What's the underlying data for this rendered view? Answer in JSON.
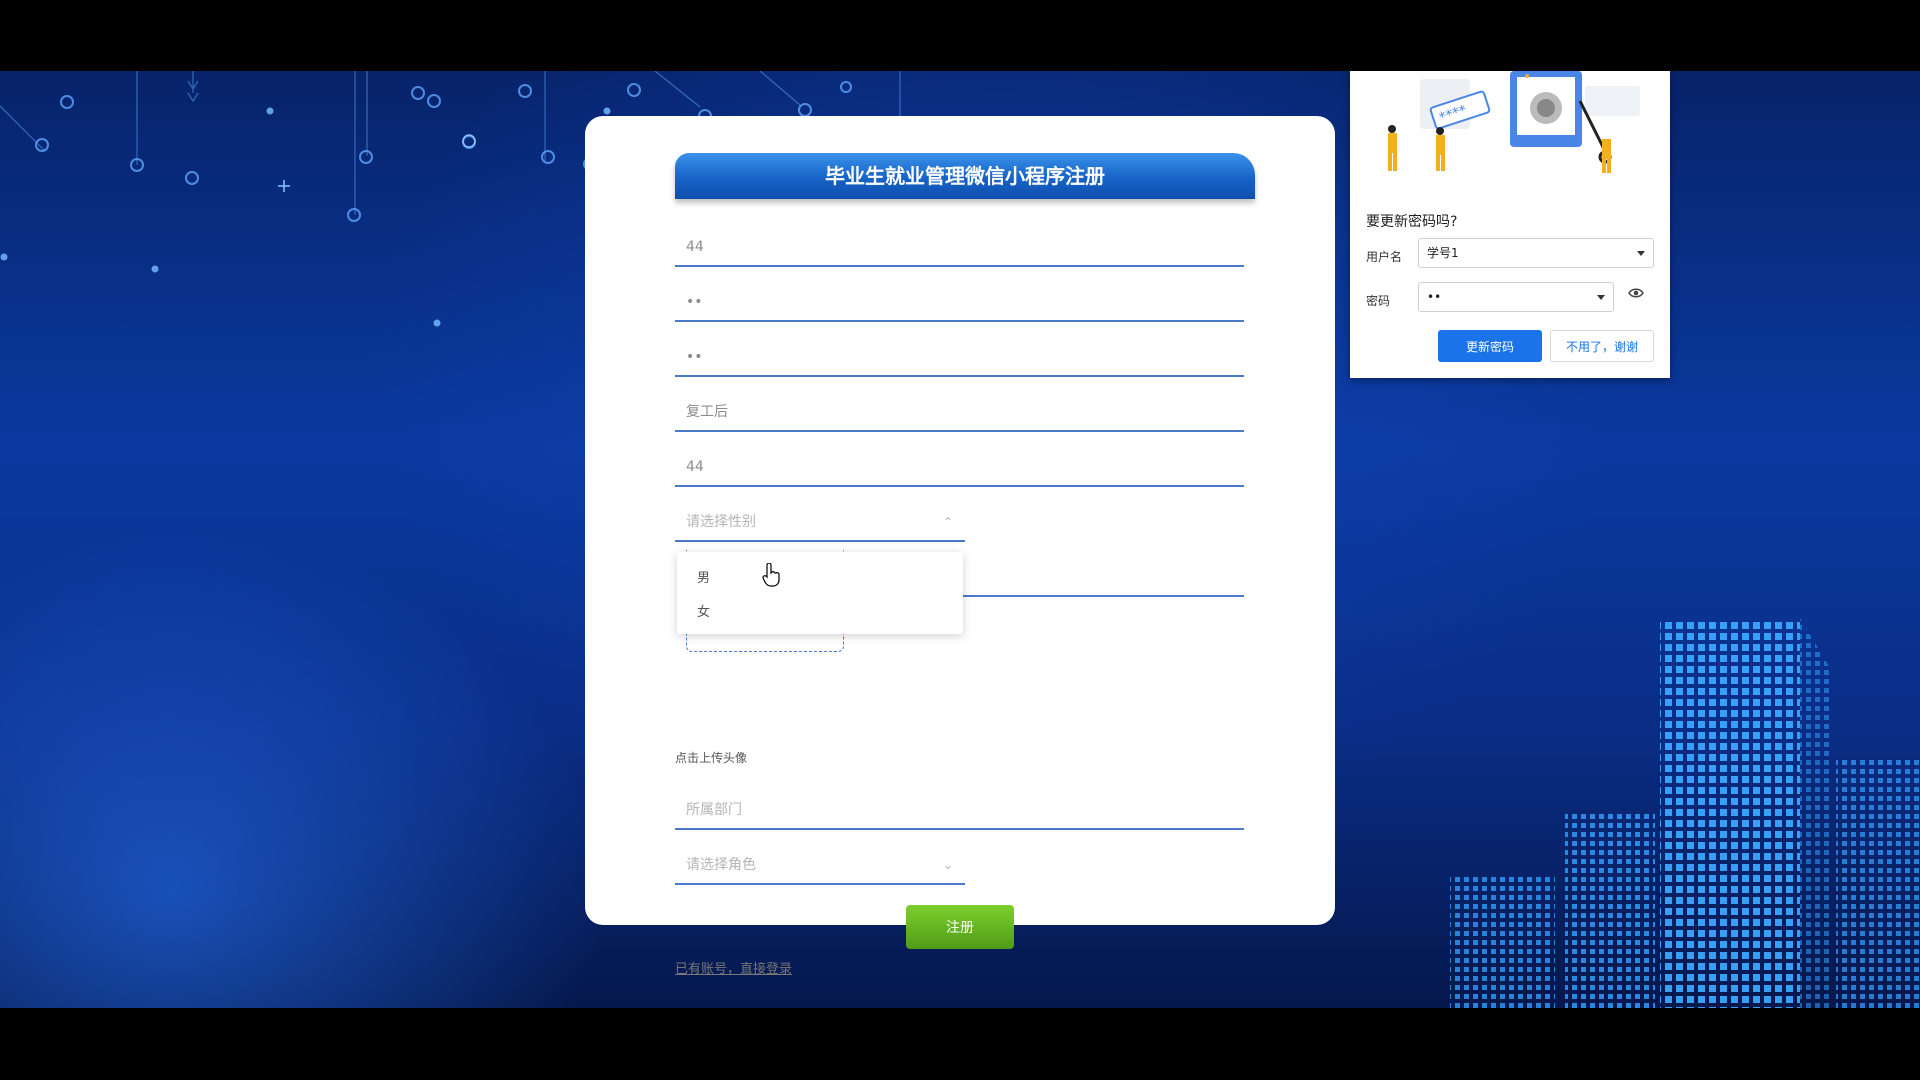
{
  "form": {
    "title": "毕业生就业管理微信小程序注册",
    "fields": {
      "account": "44",
      "password": "••",
      "confirm_password": "••",
      "name": "复工后",
      "phone": "44",
      "gender_placeholder": "请选择性别",
      "department_placeholder": "所属部门",
      "role_placeholder": "请选择角色"
    },
    "gender_options": [
      "男",
      "女"
    ],
    "upload_hint": "点击上传头像",
    "register_button": "注册",
    "login_link": "已有账号，直接登录"
  },
  "password_prompt": {
    "title": "要更新密码吗?",
    "username_label": "用户名",
    "username_value": "学号1",
    "password_label": "密码",
    "password_value": "••",
    "update_button": "更新密码",
    "dismiss_button": "不用了，谢谢",
    "accent_color": "#1a73e8"
  },
  "icons": {
    "eye": "eye-icon",
    "upload": "plus-icon",
    "dropdown": "chevron-icon",
    "pointer": "hand-cursor-icon"
  }
}
